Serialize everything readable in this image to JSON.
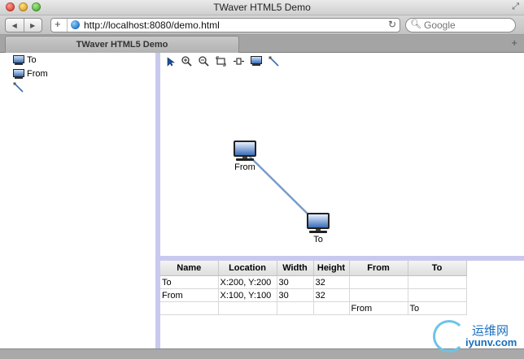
{
  "window": {
    "title": "TWaver HTML5 Demo"
  },
  "browser": {
    "url": "http://localhost:8080/demo.html",
    "search_placeholder": "Google",
    "tab_title": "TWaver HTML5 Demo"
  },
  "tree": {
    "items": [
      {
        "label": "To",
        "icon": "monitor-icon"
      },
      {
        "label": "From",
        "icon": "monitor-icon"
      },
      {
        "label": "",
        "icon": "link-icon"
      }
    ]
  },
  "canvas_toolbar": [
    {
      "name": "select-tool-icon"
    },
    {
      "name": "zoom-in-icon"
    },
    {
      "name": "zoom-out-icon"
    },
    {
      "name": "zoom-overview-icon"
    },
    {
      "name": "zoom-reset-icon"
    },
    {
      "name": "add-node-icon"
    },
    {
      "name": "add-link-icon"
    }
  ],
  "graph": {
    "nodes": [
      {
        "id": "from",
        "label": "From"
      },
      {
        "id": "to",
        "label": "To"
      }
    ],
    "link_color": "#7a9cc8"
  },
  "table": {
    "columns": [
      "Name",
      "Location",
      "Width",
      "Height",
      "From",
      "To"
    ],
    "rows": [
      [
        "To",
        "X:200, Y:200",
        "30",
        "32",
        "",
        ""
      ],
      [
        "From",
        "X:100, Y:100",
        "30",
        "32",
        "",
        ""
      ],
      [
        "",
        "",
        "",
        "",
        "From",
        "To"
      ]
    ]
  },
  "watermark": {
    "top": "运维网",
    "bottom": "iyunv.com"
  },
  "colors": {
    "splitter": "#c9c9ef",
    "accent": "#3a6db8"
  }
}
